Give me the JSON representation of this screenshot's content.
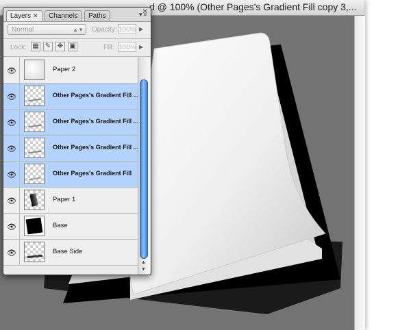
{
  "document": {
    "title": "d @ 100% (Other Pages's Gradient Fill copy 3,..."
  },
  "palette": {
    "tabs": [
      {
        "label": "Layers",
        "close": "✕"
      },
      {
        "label": "Channels"
      },
      {
        "label": "Paths"
      }
    ],
    "close_glyph": "✕",
    "menu_glyph": "▼≡",
    "blend_mode": "Normal",
    "opacity_label": "Opacity:",
    "opacity_value": "100%",
    "lock_label": "Lock:",
    "fill_label": "Fill:",
    "fill_value": "100%",
    "layers": [
      {
        "name": "Paper 2",
        "selected": false,
        "thumb": "light"
      },
      {
        "name": "Other Pages's Gradient Fill ...",
        "selected": true,
        "thumb": "transparent"
      },
      {
        "name": "Other Pages's Gradient Fill ...",
        "selected": true,
        "thumb": "transparent"
      },
      {
        "name": "Other Pages's Gradient Fill ...",
        "selected": true,
        "thumb": "transparent"
      },
      {
        "name": "Other Pages's Gradient Fill",
        "selected": true,
        "thumb": "transparent"
      },
      {
        "name": "Paper 1",
        "selected": false,
        "thumb": "transparent"
      },
      {
        "name": "Base",
        "selected": false,
        "thumb": "base"
      },
      {
        "name": "Base Side",
        "selected": false,
        "thumb": "transparent"
      }
    ]
  },
  "colors": {
    "selection": "#b4d4ff",
    "canvas": "#737373",
    "scroll_thumb": "#5a9ee6"
  }
}
